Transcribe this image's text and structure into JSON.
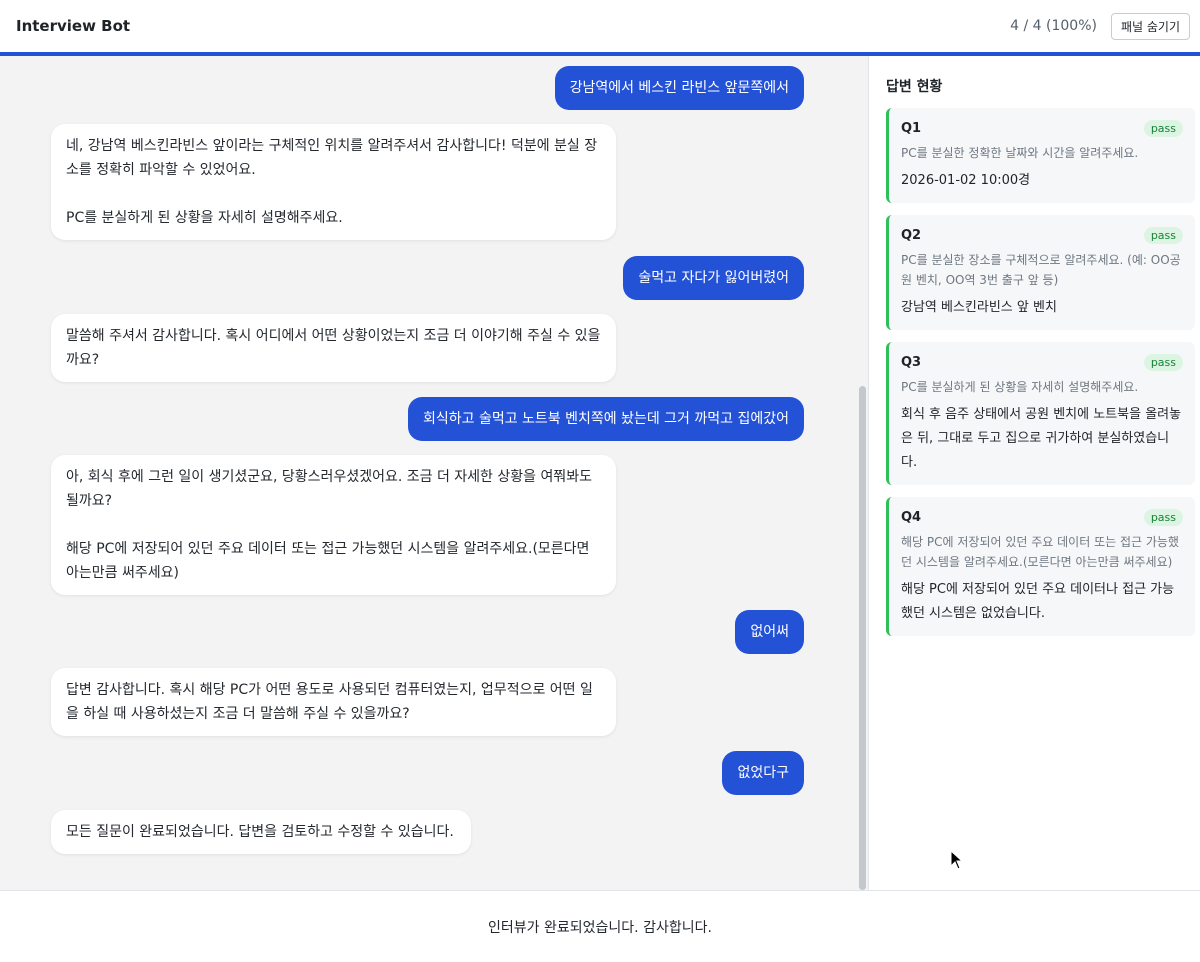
{
  "header": {
    "title": "Interview Bot",
    "progress": "4 / 4 (100%)",
    "hide_panel_label": "패널 숨기기"
  },
  "messages": [
    {
      "role": "user",
      "text": "강남역에서 베스킨 라빈스 앞문쪽에서"
    },
    {
      "role": "bot",
      "text": "네, 강남역 베스킨라빈스 앞이라는 구체적인 위치를 알려주셔서 감사합니다! 덕분에 분실 장소를 정확히 파악할 수 있었어요.\n\nPC를 분실하게 된 상황을 자세히 설명해주세요."
    },
    {
      "role": "user",
      "text": "술먹고 자다가 잃어버렸어"
    },
    {
      "role": "bot",
      "text": "말씀해 주셔서 감사합니다. 혹시 어디에서 어떤 상황이었는지 조금 더 이야기해 주실 수 있을까요?"
    },
    {
      "role": "user",
      "text": "회식하고 술먹고 노트북 벤치쪽에 놨는데 그거 까먹고 집에갔어"
    },
    {
      "role": "bot",
      "text": "아, 회식 후에 그런 일이 생기셨군요, 당황스러우셨겠어요. 조금 더 자세한 상황을 여쭤봐도 될까요?\n\n해당 PC에 저장되어 있던 주요 데이터 또는 접근 가능했던 시스템을 알려주세요.(모른다면 아는만큼 써주세요)"
    },
    {
      "role": "user",
      "text": "없어써"
    },
    {
      "role": "bot",
      "text": "답변 감사합니다. 혹시 해당 PC가 어떤 용도로 사용되던 컴퓨터였는지, 업무적으로 어떤 일을 하실 때 사용하셨는지 조금 더 말씀해 주실 수 있을까요?"
    },
    {
      "role": "user",
      "text": "없었다구"
    },
    {
      "role": "bot",
      "text": "모든 질문이 완료되었습니다. 답변을 검토하고 수정할 수 있습니다."
    }
  ],
  "panel": {
    "title": "답변 현황",
    "questions": [
      {
        "id": "Q1",
        "status": "pass",
        "question": "PC를 분실한 정확한 날짜와 시간을 알려주세요.",
        "answer": "2026-01-02 10:00경"
      },
      {
        "id": "Q2",
        "status": "pass",
        "question": "PC를 분실한 장소를 구체적으로 알려주세요. (예: OO공원 벤치, OO역 3번 출구 앞 등)",
        "answer": "강남역 베스킨라빈스 앞 벤치"
      },
      {
        "id": "Q3",
        "status": "pass",
        "question": "PC를 분실하게 된 상황을 자세히 설명해주세요.",
        "answer": "회식 후 음주 상태에서 공원 벤치에 노트북을 올려놓은 뒤, 그대로 두고 집으로 귀가하여 분실하였습니다."
      },
      {
        "id": "Q4",
        "status": "pass",
        "question": "해당 PC에 저장되어 있던 주요 데이터 또는 접근 가능했던 시스템을 알려주세요.(모른다면 아는만큼 써주세요)",
        "answer": "해당 PC에 저장되어 있던 주요 데이터나 접근 가능했던 시스템은 없었습니다."
      }
    ]
  },
  "footer": {
    "status_text": "인터뷰가 완료되었습니다. 감사합니다."
  },
  "colors": {
    "accent": "#2452d6",
    "pass_border": "#2fbf5a",
    "pass_badge_bg": "#dcf5e3",
    "pass_badge_text": "#1a7f37"
  }
}
